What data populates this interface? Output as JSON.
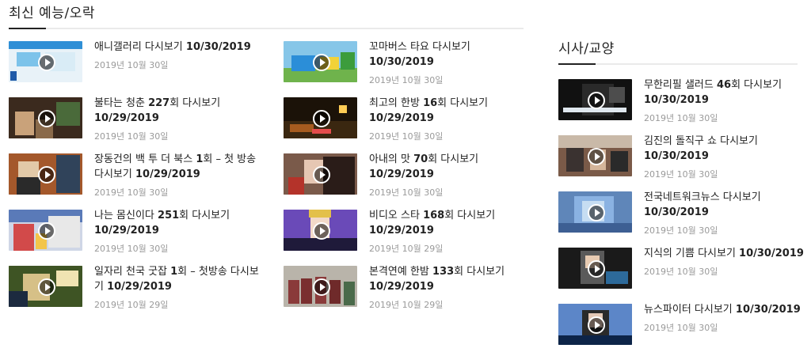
{
  "sections": {
    "entertainment": {
      "title": "최신 예능/오락",
      "col1": [
        {
          "title": "애니갤러리 다시보기 10/30/2019",
          "date": "2019년 10월 30일",
          "thumb": "kids-gallery"
        },
        {
          "title": "불타는 청춘 227회 다시보기 10/29/2019",
          "date": "2019년 10월 30일",
          "thumb": "people-outdoor"
        },
        {
          "title": "장동건의 백 투 더 북스 1회 – 첫 방송 다시보기 10/29/2019",
          "date": "2019년 10월 30일",
          "thumb": "bookshelf"
        },
        {
          "title": "나는 몸신이다 251회 다시보기 10/29/2019",
          "date": "2019년 10월 30일",
          "thumb": "studio-game"
        },
        {
          "title": "일자리 천국 굿잡 1회 – 첫방송 다시보기 10/29/2019",
          "date": "2019년 10월 29일",
          "thumb": "green-room"
        }
      ],
      "col2": [
        {
          "title": "꼬마버스 타요 다시보기 10/30/2019",
          "date": "2019년 10월 30일",
          "thumb": "bus-cartoon"
        },
        {
          "title": "최고의 한방 16회 다시보기 10/29/2019",
          "date": "2019년 10월 30일",
          "thumb": "night-lights"
        },
        {
          "title": "아내의 맛 70회 다시보기 10/29/2019",
          "date": "2019년 10월 30일",
          "thumb": "couple"
        },
        {
          "title": "비디오 스타 168회 다시보기 10/29/2019",
          "date": "2019년 10월 29일",
          "thumb": "stage"
        },
        {
          "title": "본격연예 한밤 133회 다시보기 10/29/2019",
          "date": "2019년 10월 29일",
          "thumb": "group-photo"
        }
      ]
    },
    "culture": {
      "title": "시사/교양",
      "items": [
        {
          "title": "무한리필 샐러드 46회 다시보기 10/30/2019",
          "date": "2019년 10월 30일",
          "thumb": "dark-talk"
        },
        {
          "title": "김진의 돌직구 쇼 다시보기 10/30/2019",
          "date": "2019년 10월 30일",
          "thumb": "panel"
        },
        {
          "title": "전국네트워크뉴스 다시보기 10/30/2019",
          "date": "2019년 10월 30일",
          "thumb": "map"
        },
        {
          "title": "지식의 기쁨 다시보기 10/30/2019",
          "date": "2019년 10월 30일",
          "thumb": "lecture"
        },
        {
          "title": "뉴스파이터 다시보기 10/30/2019",
          "date": "2019년 10월 30일",
          "thumb": "news-anchor"
        }
      ]
    }
  },
  "colors": {
    "accent": "#222222",
    "rule": "#eaeaea",
    "date": "#9a9a9a"
  }
}
